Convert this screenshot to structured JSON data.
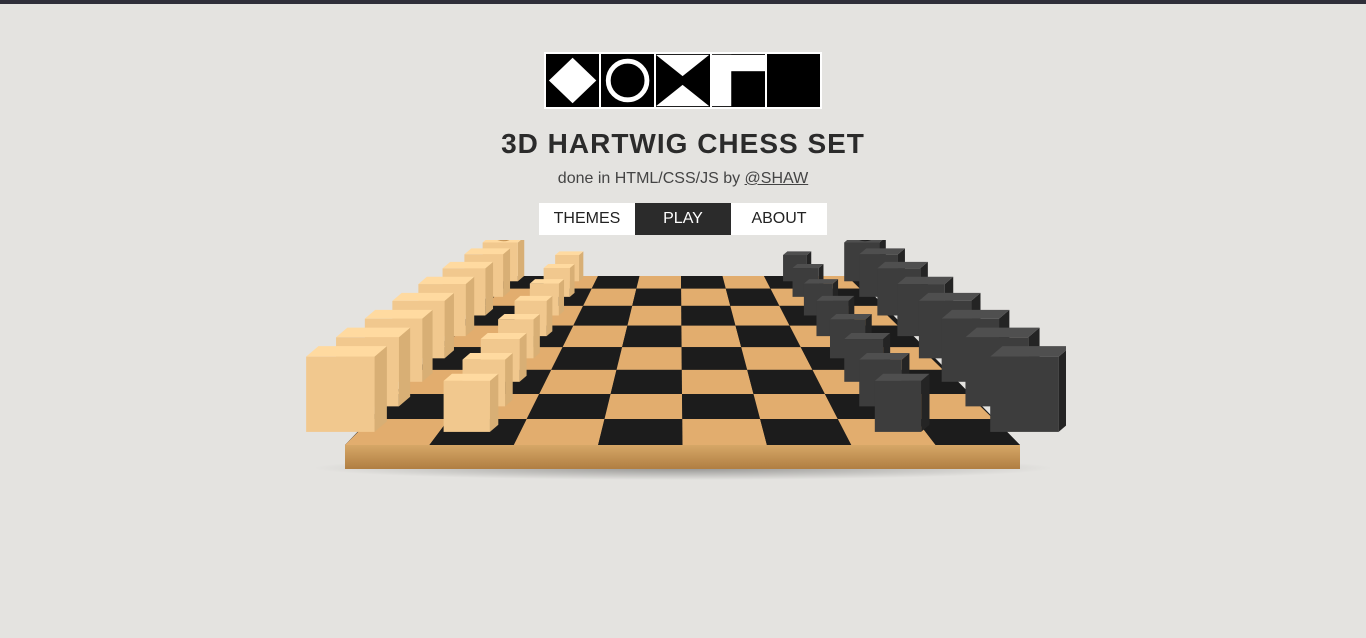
{
  "header": {
    "logo_tiles": [
      "diamond-icon",
      "circle-icon",
      "x-icon",
      "corner-icon",
      "square-icon"
    ],
    "title": "3D HARTWIG CHESS SET",
    "subtitle_prefix": "done in HTML/CSS/JS by",
    "author_link": "@SHAW"
  },
  "nav": {
    "items": [
      {
        "label": "THEMES",
        "active": false
      },
      {
        "label": "PLAY",
        "active": true
      },
      {
        "label": "ABOUT",
        "active": false
      }
    ]
  },
  "colors": {
    "background": "#e4e3e0",
    "light_square": "#e2ad6e",
    "dark_square": "#1c1c1c",
    "light_piece": "#f1c88e",
    "dark_piece": "#3d3d3d",
    "board_frame": "#c99a5c"
  }
}
